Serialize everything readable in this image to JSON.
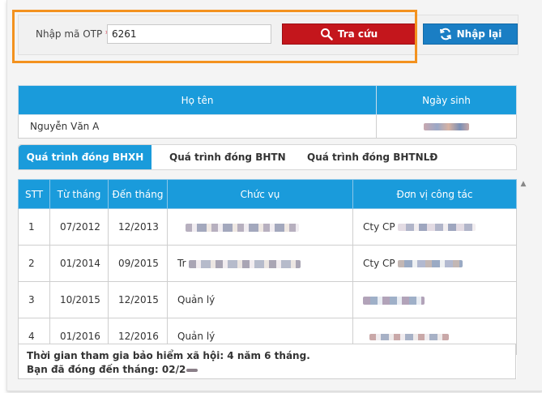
{
  "search": {
    "otp_label": "Nhập mã OTP",
    "required_mark": "*",
    "otp_value": "6261",
    "search_button": "Tra cứu",
    "reset_button": "Nhập lại"
  },
  "person": {
    "headers": [
      "Họ tên",
      "Ngày sinh"
    ],
    "name": "Nguyễn Văn A"
  },
  "tabs": [
    "Quá trình đóng BHXH",
    "Quá trình đóng BHTN",
    "Quá trình đóng BHTNLĐ"
  ],
  "process": {
    "headers": [
      "STT",
      "Từ tháng",
      "Đến tháng",
      "Chức vụ",
      "Đơn vị công tác"
    ],
    "rows": [
      {
        "stt": "1",
        "from": "07/2012",
        "to": "12/2013",
        "position": "",
        "unit": "Cty CP"
      },
      {
        "stt": "2",
        "from": "01/2014",
        "to": "09/2015",
        "position": "Tr",
        "unit": "Cty CP"
      },
      {
        "stt": "3",
        "from": "10/2015",
        "to": "12/2015",
        "position": "Quản lý",
        "unit": ""
      },
      {
        "stt": "4",
        "from": "01/2016",
        "to": "12/2016",
        "position": "Quản lý",
        "unit": ""
      }
    ]
  },
  "summary": {
    "line1": "Thời gian tham gia bảo hiểm xã hội: 4 năm 6 tháng.",
    "line2": "Bạn đã đóng đến tháng: 02/2"
  },
  "colors": {
    "accent": "#1a9bdb",
    "search_button": "#c4161c",
    "reset_button": "#1a7ec4",
    "highlight": "#f3921f"
  }
}
